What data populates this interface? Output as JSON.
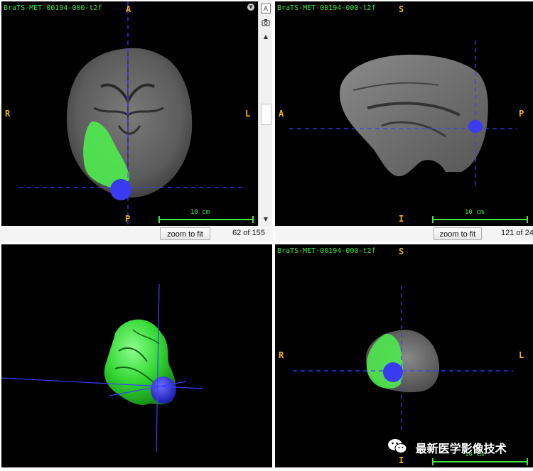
{
  "panels": {
    "axial": {
      "volume_name": "BraTS-MET-00194-000-t2f",
      "orient_top": "A",
      "orient_bottom": "P",
      "orient_left": "R",
      "orient_right": "L",
      "scale_label": "10 cm",
      "zoom_label": "zoom to fit",
      "slice_counter": "62 of 155"
    },
    "sagittal": {
      "volume_name": "BraTS-MET-00194-000-t2f",
      "orient_top": "S",
      "orient_bottom": "I",
      "orient_left": "A",
      "orient_right": "P",
      "scale_label": "10 cm",
      "zoom_label": "zoom to fit",
      "slice_counter": "121 of 24"
    },
    "coronal": {
      "volume_name": "BraTS-MET-00194-000-t2f",
      "orient_top": "S",
      "orient_bottom": "I",
      "orient_left": "R",
      "orient_right": "L",
      "scale_label": "10 cm"
    }
  },
  "toolbar": {
    "label_toggle": "A"
  },
  "watermark": {
    "text": "最新医学影像技术"
  },
  "colors": {
    "edema": "#4fe84f",
    "tumor": "#3a3af0",
    "crosshair": "#3d3dff",
    "orient": "#f2b51a",
    "label": "#3ee63e"
  }
}
